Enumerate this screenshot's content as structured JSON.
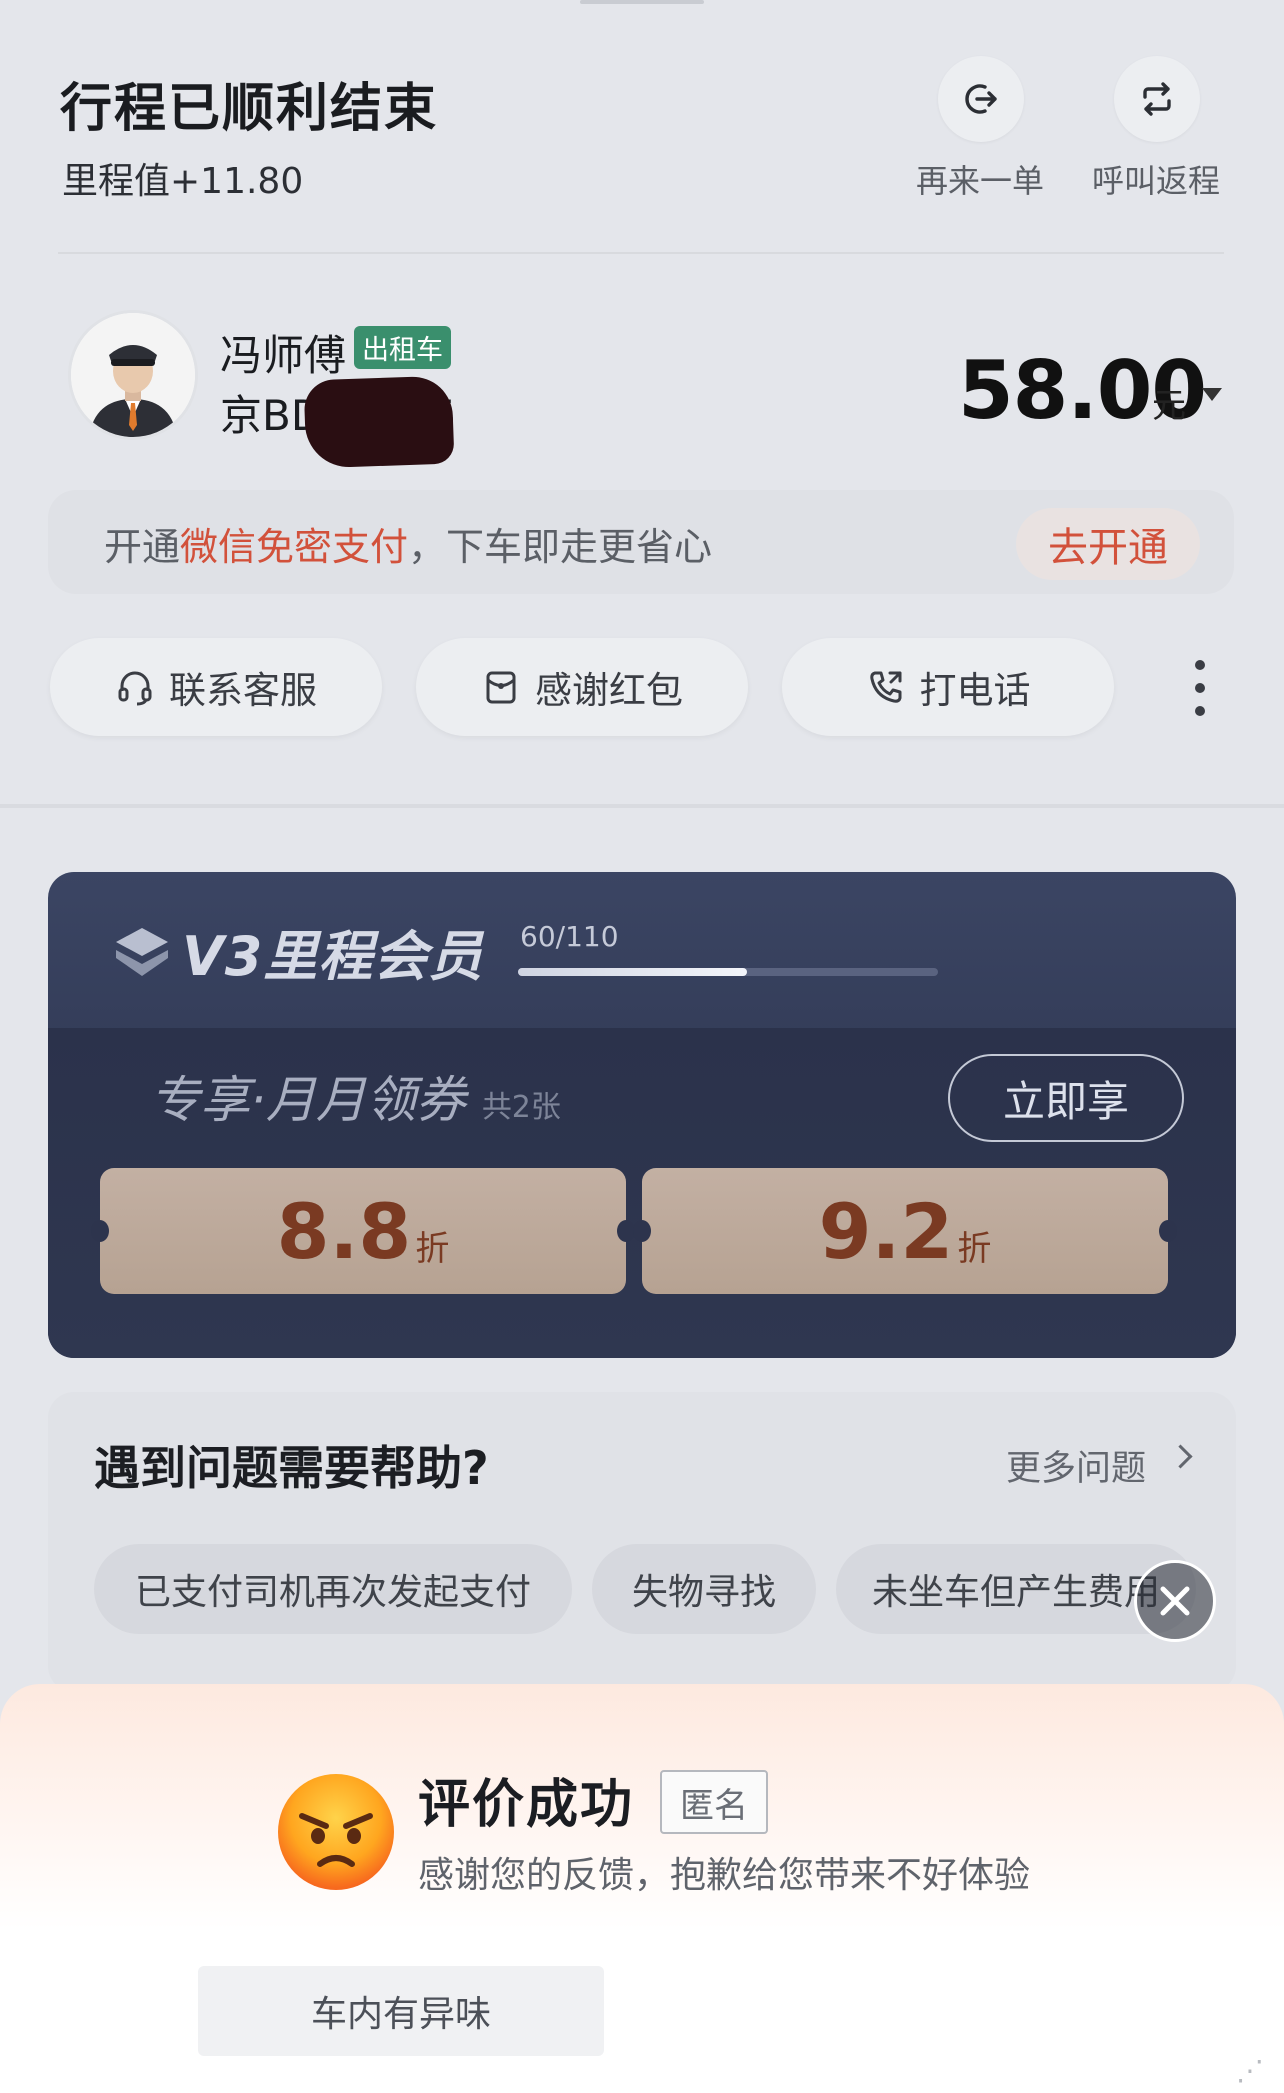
{
  "header": {
    "title": "行程已顺利结束",
    "mileage": "里程值+11.80",
    "actions": [
      {
        "label": "再来一单",
        "icon": "reorder-icon"
      },
      {
        "label": "呼叫返程",
        "icon": "return-trip-icon"
      }
    ]
  },
  "driver": {
    "name": "冯师傅",
    "tag": "出租车",
    "plate": "京BD16325",
    "plate_redacted": true
  },
  "fare": {
    "amount": "58.00",
    "unit": "元"
  },
  "payment_promo": {
    "text_before": "开通",
    "highlight": "微信免密支付",
    "text_after": "，下车即走更省心",
    "button": "去开通",
    "highlight_color": "#d2513b"
  },
  "quick_actions": [
    {
      "label": "联系客服",
      "icon": "headset-icon"
    },
    {
      "label": "感谢红包",
      "icon": "red-envelope-icon"
    },
    {
      "label": "打电话",
      "icon": "phone-icon"
    }
  ],
  "membership": {
    "title": "V3里程会员",
    "progress_text": "60/110",
    "progress_current": 60,
    "progress_total": 110,
    "subtitle": "专享·月月领券",
    "count": "共2张",
    "button": "立即享",
    "coupons": [
      {
        "value": "8.8",
        "unit": "折"
      },
      {
        "value": "9.2",
        "unit": "折"
      }
    ]
  },
  "help": {
    "title": "遇到问题需要帮助?",
    "more": "更多问题",
    "questions": [
      "已支付司机再次发起支付",
      "失物寻找",
      "未坐车但产生费用"
    ]
  },
  "rating": {
    "title": "评价成功",
    "anonymous": "匿名",
    "subtitle": "感谢您的反馈，抱歉给您带来不好体验",
    "tags": [
      "车内有异味"
    ],
    "emoji": "angry-face-icon"
  },
  "colors": {
    "accent_red": "#d2513b",
    "taxi_green": "#3a8f6d",
    "vip_bg": "#343d59"
  }
}
